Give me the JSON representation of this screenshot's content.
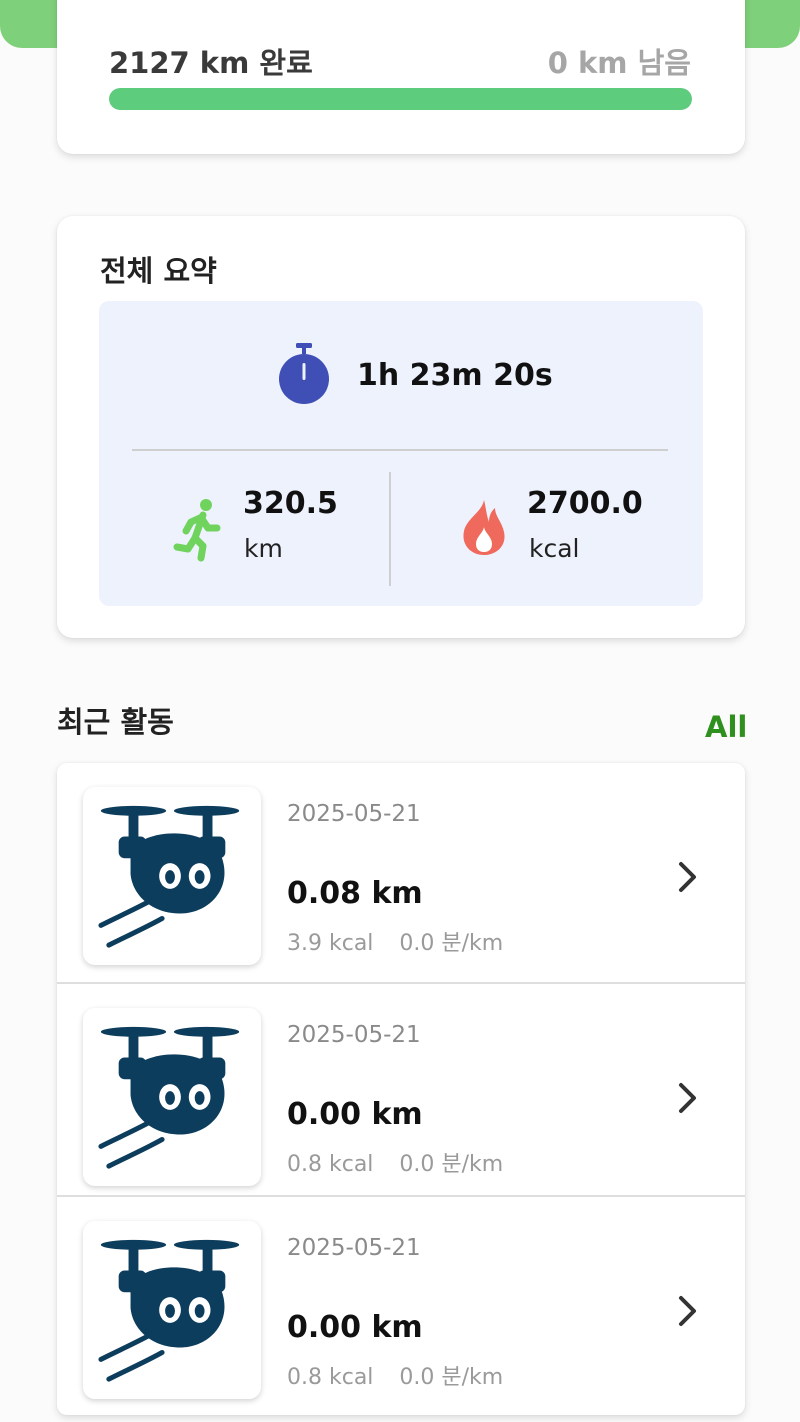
{
  "progress": {
    "completed_label": "2127 km 완료",
    "remaining_label": "0 km 남음",
    "fraction": 1.0,
    "bar_color": "#5dcc7c"
  },
  "summary": {
    "title": "전체 요약",
    "duration": "1h 23m 20s",
    "distance_value": "320.5",
    "distance_unit": "km",
    "calories_value": "2700.0",
    "calories_unit": "kcal",
    "icons": [
      "stopwatch-icon",
      "running-icon",
      "flame-icon"
    ],
    "accent_colors": {
      "stopwatch": "#3f4fb5",
      "runner": "#6fd35e",
      "flame": "#ef6a5c"
    }
  },
  "recent": {
    "title": "최근 활동",
    "all_label": "All",
    "all_color": "#2f8f1f",
    "items": [
      {
        "date": "2025-05-21",
        "distance": "0.08 km",
        "calories": "3.9 kcal",
        "pace": "0.0 분/km"
      },
      {
        "date": "2025-05-21",
        "distance": "0.00 km",
        "calories": "0.8 kcal",
        "pace": "0.0 분/km"
      },
      {
        "date": "2025-05-21",
        "distance": "0.00 km",
        "calories": "0.8 kcal",
        "pace": "0.0 분/km"
      }
    ],
    "thumbnail_icon": "drone-mascot-icon",
    "mascot_color": "#0d3d5c"
  }
}
